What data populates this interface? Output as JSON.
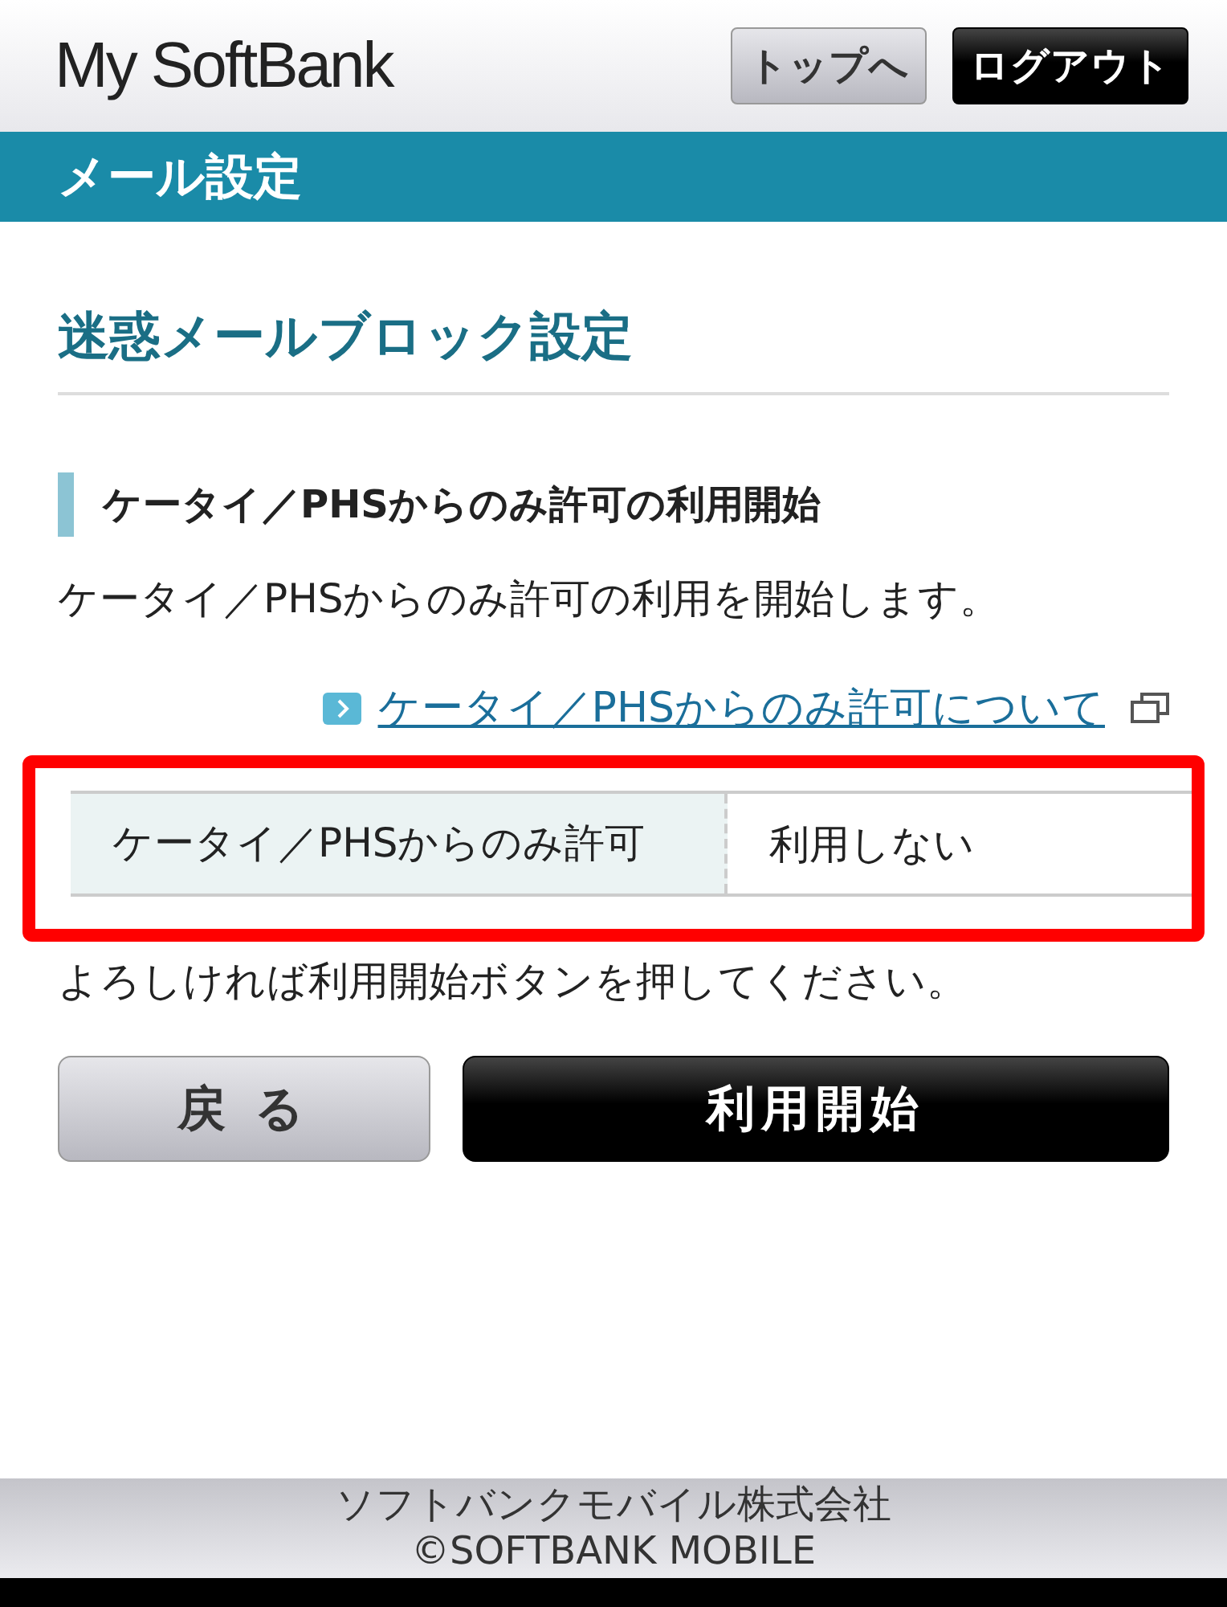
{
  "header": {
    "logo": "My SoftBank",
    "buttons": [
      {
        "label": "トップへ",
        "kind": "secondary"
      },
      {
        "label": "ログアウト",
        "kind": "primary"
      }
    ]
  },
  "section_bar": {
    "title": "メール設定"
  },
  "page_title": "迷惑メールブロック設定",
  "subsection": {
    "heading": "ケータイ／PHSからのみ許可の利用開始",
    "description": "ケータイ／PHSからのみ許可の利用を開始します。",
    "link": "ケータイ／PHSからのみ許可について"
  },
  "settings_table": {
    "highlighted": true,
    "rows": [
      {
        "label": "ケータイ／PHSからのみ許可",
        "value": "利用しない"
      }
    ]
  },
  "note": "よろしければ利用開始ボタンを押してください。",
  "actions": [
    {
      "label": "戻 る",
      "kind": "secondary"
    },
    {
      "label": "利用開始",
      "kind": "primary"
    }
  ],
  "footer": {
    "company": "ソフトバンクモバイル株式会社",
    "copyright": "©SOFTBANK MOBILE"
  }
}
